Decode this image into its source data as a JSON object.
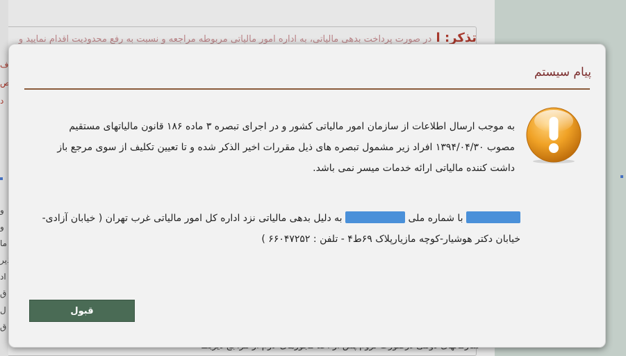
{
  "background": {
    "heading_main": "تذکر: ا",
    "heading_faint": "در صورت پرداخت بدهی مالیاتی، به اداره امور مالیاتی مربوطه مراجعه و نسبت به رفع محدودیت اقدام نمایید و",
    "left_fragments_red": [
      "ف",
      "ص",
      "د"
    ],
    "left_fragments_dark": [
      "و",
      "و",
      "ما",
      "ذیر",
      "اد",
      "ق",
      "ل",
      "ق"
    ],
    "bottom_text": "سازمانهای دولتی درصورت لزوم پس از اخذ مجوزهای لازم از مراجع ذیربط"
  },
  "dialog": {
    "title": "پیام سیستم",
    "icon": "exclamation-icon",
    "message_main": "به موجب ارسال اطلاعات از سازمان امور مالیاتی کشور و در اجرای تبصره ۳ ماده ۱۸۶ قانون مالیاتهای مستقیم مصوب ۱۳۹۴/۰۴/۳۰ افراد زیر مشمول تبصره های ذیل مقررات اخیر الذکر شده و تا تعیین تکلیف از سوی مرجع باز داشت کننده مالیاتی ارائه خدمات میسر نمی باشد.",
    "debt_part1": "با شماره ملی",
    "debt_part2": "به دلیل بدهی مالیاتی نزد اداره کل امور مالیاتی غرب تهران ( خیابان آزادی-خیابان دکتر هوشیار-کوچه مازیارپلاک ۶۹ط۴ - تلفن : ۶۶۰۴۷۲۵۲ )",
    "accept_label": "قبول"
  },
  "colors": {
    "title_text": "#7a2b2b",
    "title_rule": "#8a5a3a",
    "accept_button": "#4a6b55",
    "redaction": "#4a90d9",
    "icon_orange": "#e89a1c",
    "bg_right_panel": "#d4e1da"
  }
}
